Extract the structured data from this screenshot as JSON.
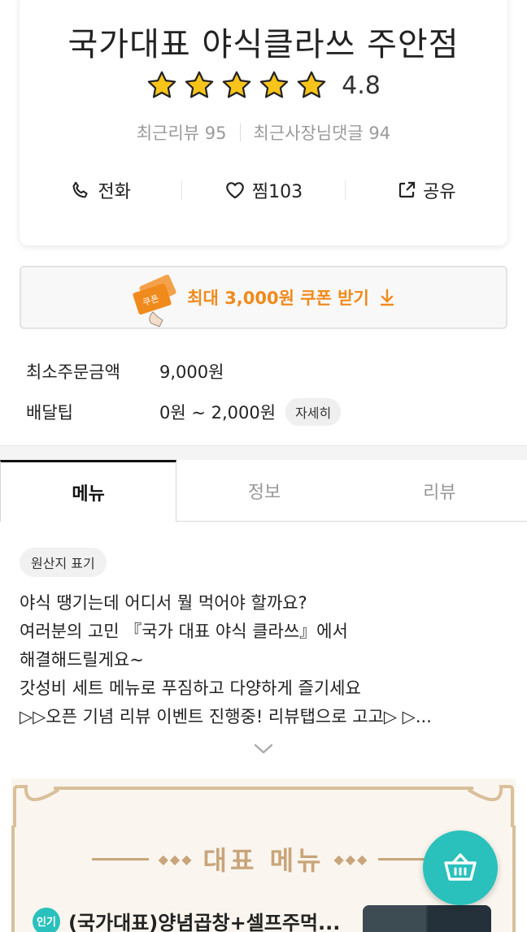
{
  "store": {
    "name": "국가대표 야식클라쓰 주안점",
    "rating": "4.8",
    "rating_value": 4.8,
    "recent_reviews": "최근리뷰 95",
    "recent_owner_replies": "최근사장님댓글 94"
  },
  "actions": {
    "call_label": "전화",
    "like_label": "찜",
    "like_count": "103",
    "share_label": "공유"
  },
  "coupon": {
    "label": "최대 3,000원 쿠폰 받기",
    "badge_text": "쿠폰"
  },
  "delivery_info": {
    "min_order_label": "최소주문금액",
    "min_order_value": "9,000원",
    "tip_label": "배달팁",
    "tip_value": "0원 ~ 2,000원",
    "detail_button": "자세히"
  },
  "tabs": [
    {
      "label": "메뉴",
      "active": true
    },
    {
      "label": "정보",
      "active": false
    },
    {
      "label": "리뷰",
      "active": false
    }
  ],
  "origin_chip": "원산지 표기",
  "notice": {
    "lines": [
      "야식 땡기는데 어디서 뭘 먹어야 할까요?",
      "여러분의 고민 『국가 대표 야식 클라쓰』에서",
      "해결해드릴게요~",
      "갓성비 세트 메뉴로 푸짐하고 다양하게 즐기세요",
      "▷▷오픈 기념 리뷰 이벤트 진행중! 리뷰탭으로 고고▷ ▷..."
    ]
  },
  "representative_menu": {
    "title": "대표 메뉴",
    "first_item": {
      "badge": "인기",
      "name": "(국가대표)양념곱창+셀프주먹..."
    }
  },
  "colors": {
    "accent_teal": "#2ac1bc",
    "coupon_orange": "#f08a1c",
    "star_yellow": "#f9c41a",
    "gold": "#c9a57b"
  },
  "icons": [
    "star-icon",
    "phone-icon",
    "heart-icon",
    "share-icon",
    "download-icon",
    "chevron-down-icon",
    "cart-icon"
  ]
}
